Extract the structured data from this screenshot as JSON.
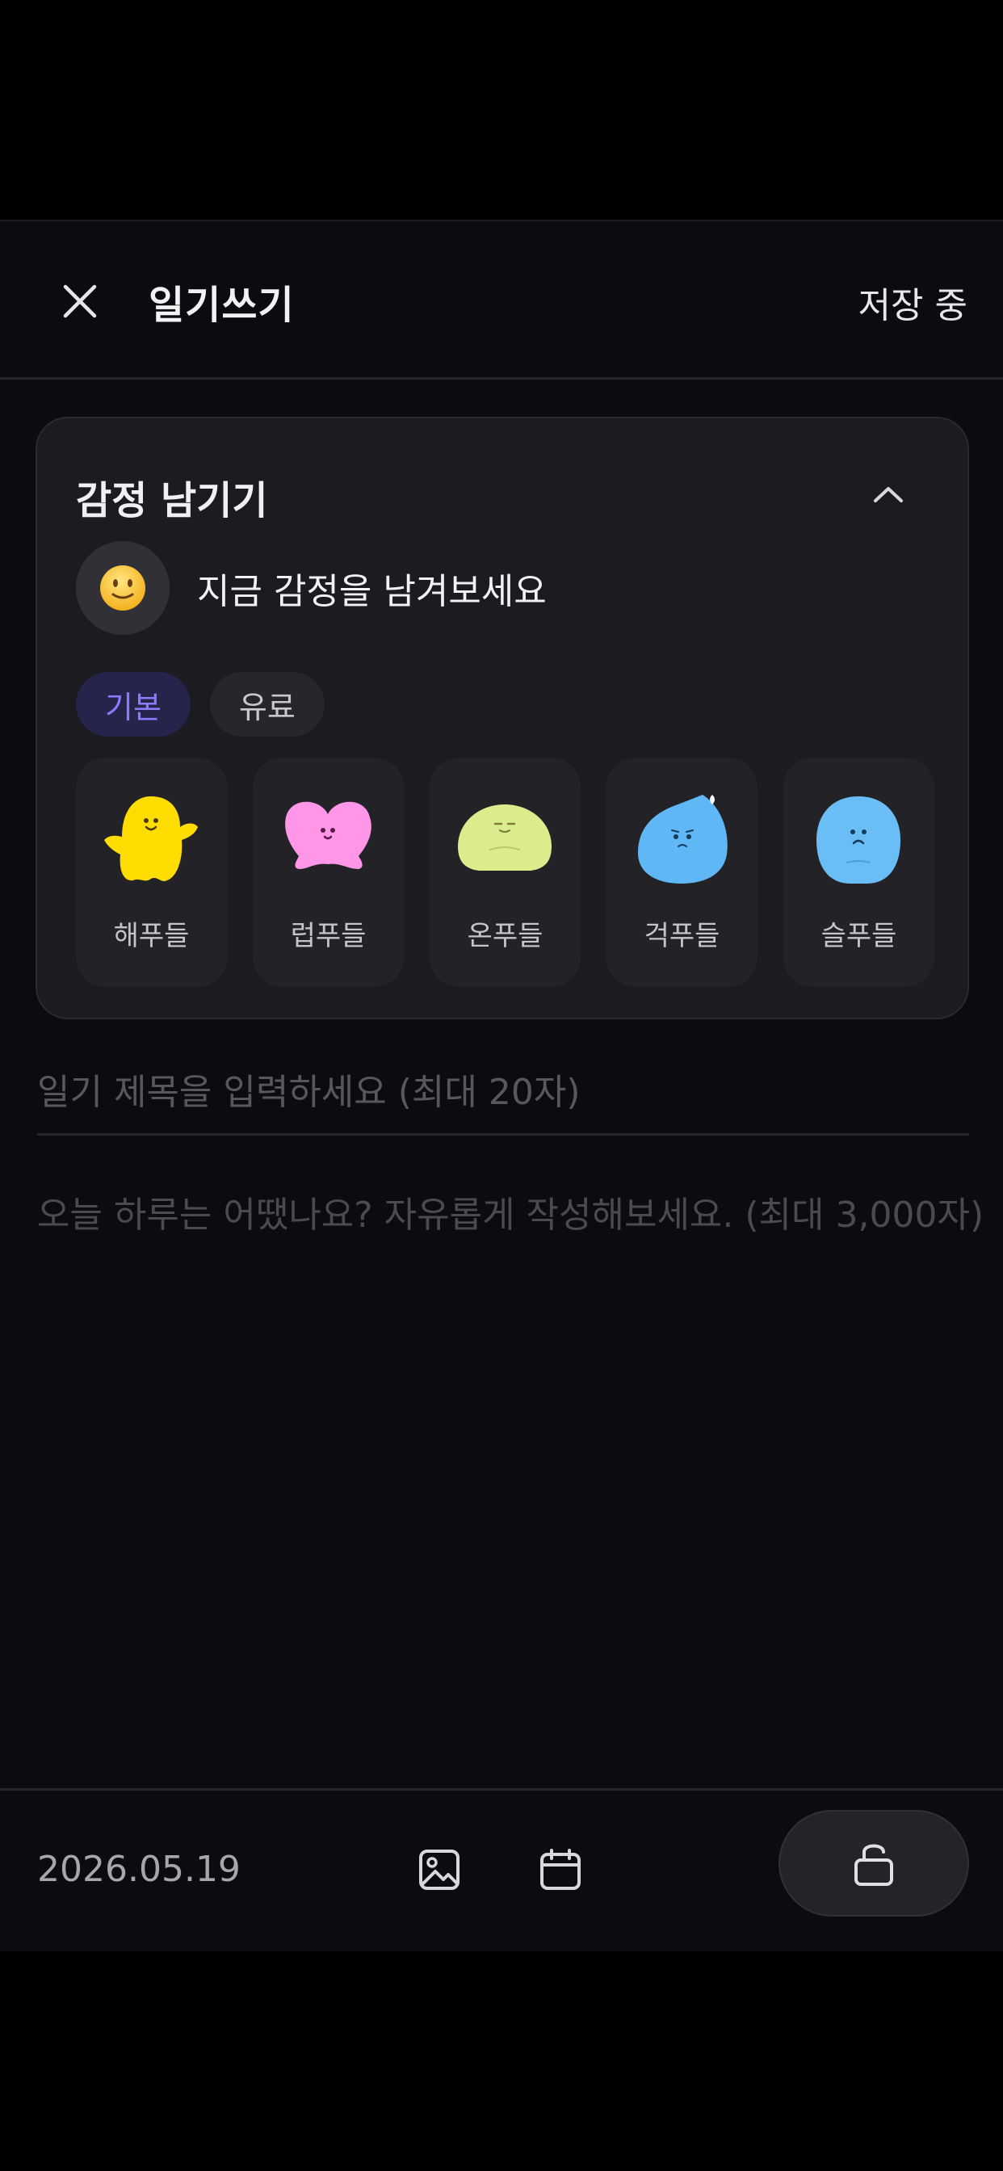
{
  "header": {
    "title": "일기쓰기",
    "status": "저장 중"
  },
  "emotion_card": {
    "title": "감정 남기기",
    "prompt": "지금 감정을 남겨보세요",
    "tabs": [
      {
        "label": "기본",
        "active": true
      },
      {
        "label": "유료",
        "active": false
      }
    ],
    "moods": [
      {
        "label": "해푸들",
        "color": "#ffdd00"
      },
      {
        "label": "럽푸들",
        "color": "#ff8fe6"
      },
      {
        "label": "온푸들",
        "color": "#dcec8c"
      },
      {
        "label": "걱푸들",
        "color": "#5fb8f5"
      },
      {
        "label": "슬푸들",
        "color": "#6bbdf6"
      }
    ]
  },
  "editor": {
    "title_placeholder": "일기 제목을 입력하세요 (최대 20자)",
    "body_placeholder": "오늘 하루는 어땠나요? 자유롭게 작성해보세요. (최대 3,000자)"
  },
  "bottom_bar": {
    "date": "2026.05.19",
    "icons": [
      "image-icon",
      "calendar-icon",
      "unlock-icon"
    ]
  },
  "colors": {
    "background": "#0c0c10",
    "card": "#1b1b20",
    "accent": "#8b7bff"
  }
}
